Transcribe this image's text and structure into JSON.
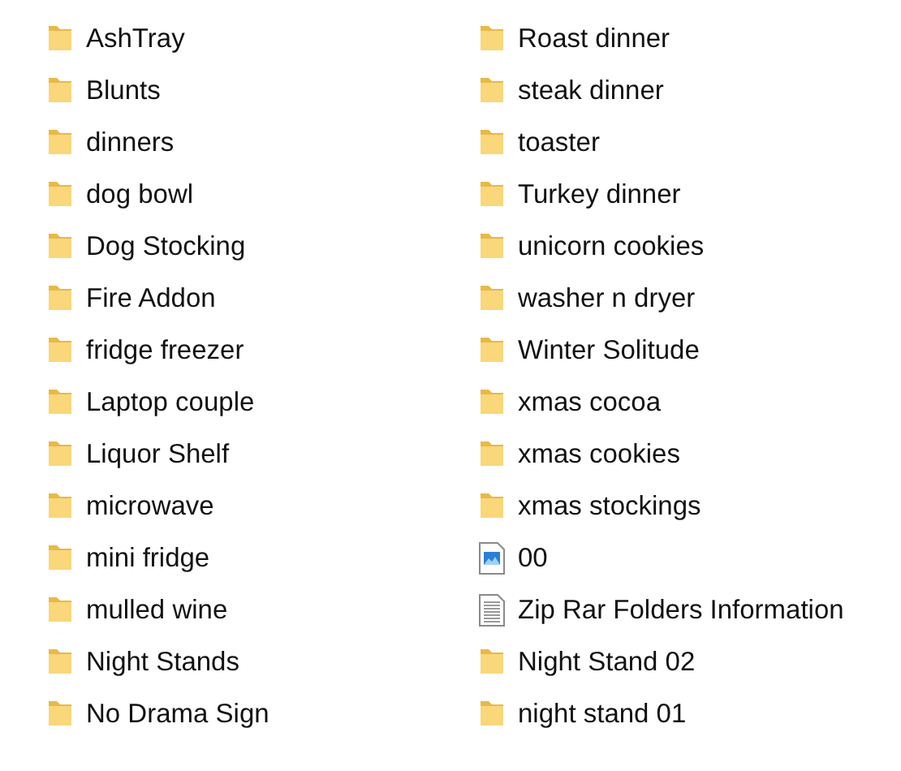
{
  "files": [
    {
      "name": "AshTray",
      "kind": "folder"
    },
    {
      "name": "Blunts",
      "kind": "folder"
    },
    {
      "name": "dinners",
      "kind": "folder"
    },
    {
      "name": "dog bowl",
      "kind": "folder"
    },
    {
      "name": "Dog Stocking",
      "kind": "folder"
    },
    {
      "name": "Fire Addon",
      "kind": "folder"
    },
    {
      "name": "fridge freezer",
      "kind": "folder"
    },
    {
      "name": "Laptop couple",
      "kind": "folder"
    },
    {
      "name": "Liquor Shelf",
      "kind": "folder"
    },
    {
      "name": "microwave",
      "kind": "folder"
    },
    {
      "name": "mini fridge",
      "kind": "folder"
    },
    {
      "name": "mulled wine",
      "kind": "folder"
    },
    {
      "name": "Night Stands",
      "kind": "folder"
    },
    {
      "name": "No Drama Sign",
      "kind": "folder"
    },
    {
      "name": "Roast dinner",
      "kind": "folder"
    },
    {
      "name": "steak dinner",
      "kind": "folder"
    },
    {
      "name": "toaster",
      "kind": "folder"
    },
    {
      "name": "Turkey dinner",
      "kind": "folder"
    },
    {
      "name": "unicorn cookies",
      "kind": "folder"
    },
    {
      "name": "washer n dryer",
      "kind": "folder"
    },
    {
      "name": "Winter Solitude",
      "kind": "folder"
    },
    {
      "name": "xmas cocoa",
      "kind": "folder"
    },
    {
      "name": "xmas cookies",
      "kind": "folder"
    },
    {
      "name": "xmas stockings",
      "kind": "folder"
    },
    {
      "name": "00",
      "kind": "image"
    },
    {
      "name": "Zip Rar Folders Information",
      "kind": "text"
    },
    {
      "name": "Night Stand 02",
      "kind": "folder"
    },
    {
      "name": "night stand 01",
      "kind": "folder"
    }
  ]
}
